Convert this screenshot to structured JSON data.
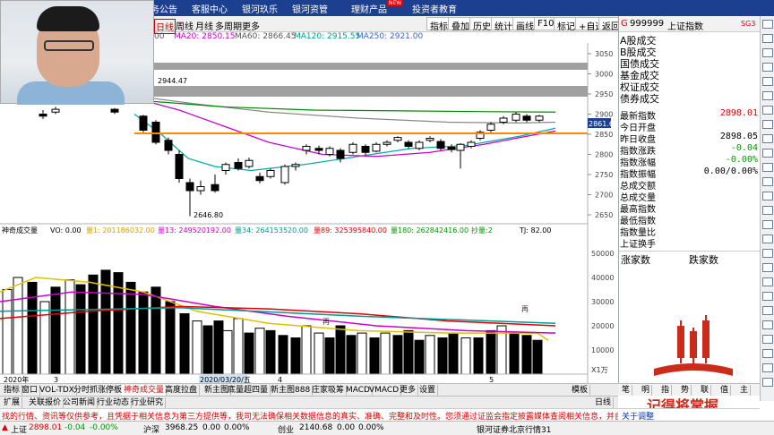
{
  "topbar": {
    "items": [
      "务公告",
      "客服中心",
      "银河玖乐",
      "银河资管",
      "理财产品",
      "投资者教育"
    ],
    "new_badge": "NEW"
  },
  "toolbar": {
    "period_items": [
      "日线",
      "周线",
      "月线",
      "多周期",
      "更多"
    ],
    "buttons": [
      "指标",
      "叠加",
      "历史",
      "统计",
      "画线",
      "F10",
      "标记",
      "+自选",
      "返回"
    ]
  },
  "ma_legend": {
    "ma_prefix": "00",
    "ma20": "MA20: 2850.15",
    "ma60": "MA60: 2866.45",
    "ma120": "MA120: 2915.55",
    "ma250": "MA250: 2921.00"
  },
  "chart_data": {
    "type": "candlestick",
    "price_axis": [
      "3050",
      "3000",
      "2950",
      "2900",
      "2850",
      "2800",
      "2750",
      "2700",
      "2650"
    ],
    "price_current_label": "2861.6",
    "low_annotation": "2646.80",
    "high_annotation": "2944.47",
    "date_labels": [
      "2020年",
      "3",
      "2020/03/20/五",
      "4",
      "5"
    ],
    "volume_legend": {
      "title": "神奇成交量",
      "vo": "VO: 0.00",
      "l1": "量1: 201186032.00",
      "l13": "量13: 249520192.00",
      "l34": "量34: 264153520.00",
      "l89": "量89: 325395840.00",
      "l180": "量180: 262842416.00",
      "tj_label": "抄量:2",
      "tj": "TJ: 82.00"
    },
    "volume_axis": [
      "50000",
      "40000",
      "30000",
      "20000",
      "10000"
    ],
    "volume_unit": "X1万",
    "volume_marker": "再"
  },
  "right_panel": {
    "code": "999999",
    "name": "上证指数",
    "header_extra": "SG3",
    "header_prefix": "G",
    "list": [
      "A股成交",
      "B股成交",
      "国债成交",
      "基金成交",
      "权证成交",
      "债券成交"
    ],
    "rows": [
      {
        "k": "最新指数",
        "v": "2898.01",
        "c": "red"
      },
      {
        "k": "今日开盘",
        "v": "",
        "c": ""
      },
      {
        "k": "昨日收盘",
        "v": "2898.05",
        "c": ""
      },
      {
        "k": "指数涨跌",
        "v": "-0.04",
        "c": "green"
      },
      {
        "k": "指数涨幅",
        "v": "-0.00%",
        "c": "green"
      },
      {
        "k": "指数振幅",
        "v": "0.00/0.00%",
        "c": ""
      },
      {
        "k": "总成交额",
        "v": "",
        "c": ""
      },
      {
        "k": "总成交量",
        "v": "",
        "c": ""
      },
      {
        "k": "最高指数",
        "v": "",
        "c": ""
      },
      {
        "k": "最低指数",
        "v": "",
        "c": ""
      },
      {
        "k": "指数量比",
        "v": "",
        "c": ""
      },
      {
        "k": "上证换手",
        "v": "",
        "c": ""
      }
    ],
    "bottom_labels": {
      "up": "涨家数",
      "down": "跌家数"
    }
  },
  "bottom_tabs_row1": [
    "指标",
    "窗口",
    "VOL-TDX",
    "分时抓涨停板",
    "神奇成交量",
    "高度拉盘",
    "新主图",
    "底量超四量",
    "新主图888",
    "庄家吸筹",
    "MACD",
    "VMACD",
    "更多",
    "设置"
  ],
  "bottom_tabs_row1_right": "模板",
  "bottom_tabs_row2": [
    "扩展",
    "关联报价",
    "公司新闻",
    "行业动态",
    "行业研究"
  ],
  "bottom_right_label": "日线",
  "ticker_text": "找的行情、资讯等仅供参考，且凭据于相关信息为第三方提供等，我司无法确保相关数据信息的真实、准确、完整和及时性。您须通过证监会指定披露媒体查阅相关信息，并自担投资风险。",
  "ticker_right": "关于调整",
  "logo": {
    "caption": "记得将掌握",
    "bars": "记得将掌握"
  },
  "rb_tabs": [
    "笔",
    "明",
    "指",
    "势",
    "联",
    "值",
    "主"
  ],
  "status": {
    "index_name": "上证",
    "index_value": "2898.01",
    "index_change": "-0.04",
    "index_pct": "-0.00%",
    "sz_label": "沪深",
    "sz_value": "3968.25",
    "sz_change": "0.00",
    "sz_pct": "0.00%",
    "cy_label": "创业",
    "cy_value": "2140.68",
    "cy_change": "0.00",
    "cy_pct": "0.00%",
    "broker": "银河证券北京行情31"
  },
  "colors": {
    "topbar": "#1c3f8f",
    "up": "#e00000",
    "down": "#009900",
    "ma_line_1": "#d4a000",
    "ma_line_2": "#cc00cc",
    "ma_line_3": "#00aaaa",
    "support_line": "#ff8800"
  }
}
